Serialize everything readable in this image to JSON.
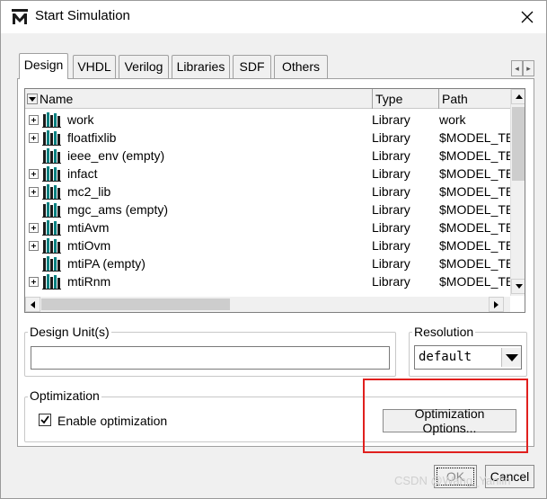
{
  "window": {
    "title": "Start Simulation",
    "app_icon": "modelsim-m-icon",
    "close_icon": "close-icon"
  },
  "tabs": [
    {
      "label": "Design",
      "active": true
    },
    {
      "label": "VHDL",
      "active": false
    },
    {
      "label": "Verilog",
      "active": false
    },
    {
      "label": "Libraries",
      "active": false
    },
    {
      "label": "SDF",
      "active": false
    },
    {
      "label": "Others",
      "active": false
    }
  ],
  "tab_scroll": {
    "left": "◂",
    "right": "▸"
  },
  "library_list": {
    "columns": [
      "Name",
      "Type",
      "Path"
    ],
    "rows": [
      {
        "name": "work",
        "type": "Library",
        "path": "work",
        "expandable": true
      },
      {
        "name": "floatfixlib",
        "type": "Library",
        "path": "$MODEL_TE",
        "expandable": true
      },
      {
        "name": "ieee_env  (empty)",
        "type": "Library",
        "path": "$MODEL_TE",
        "expandable": false
      },
      {
        "name": "infact",
        "type": "Library",
        "path": "$MODEL_TE",
        "expandable": true
      },
      {
        "name": "mc2_lib",
        "type": "Library",
        "path": "$MODEL_TE",
        "expandable": true
      },
      {
        "name": "mgc_ams  (empty)",
        "type": "Library",
        "path": "$MODEL_TE",
        "expandable": false
      },
      {
        "name": "mtiAvm",
        "type": "Library",
        "path": "$MODEL_TE",
        "expandable": true
      },
      {
        "name": "mtiOvm",
        "type": "Library",
        "path": "$MODEL_TE",
        "expandable": true
      },
      {
        "name": "mtiPA  (empty)",
        "type": "Library",
        "path": "$MODEL_TE",
        "expandable": false
      },
      {
        "name": "mtiRnm",
        "type": "Library",
        "path": "$MODEL_TE",
        "expandable": true
      }
    ]
  },
  "design_unit": {
    "label": "Design Unit(s)",
    "value": ""
  },
  "resolution": {
    "label": "Resolution",
    "value": "default"
  },
  "optimization": {
    "label": "Optimization",
    "enable_label": "Enable optimization",
    "enabled": true,
    "options_button": "Optimization Options..."
  },
  "footer": {
    "ok": "OK",
    "cancel": "Cancel"
  },
  "watermark": "CSDN @Wang_Yanlin",
  "colors": {
    "highlight": "#e0201e",
    "icon_teal": "#008080",
    "icon_dark": "#1b1b1b"
  }
}
